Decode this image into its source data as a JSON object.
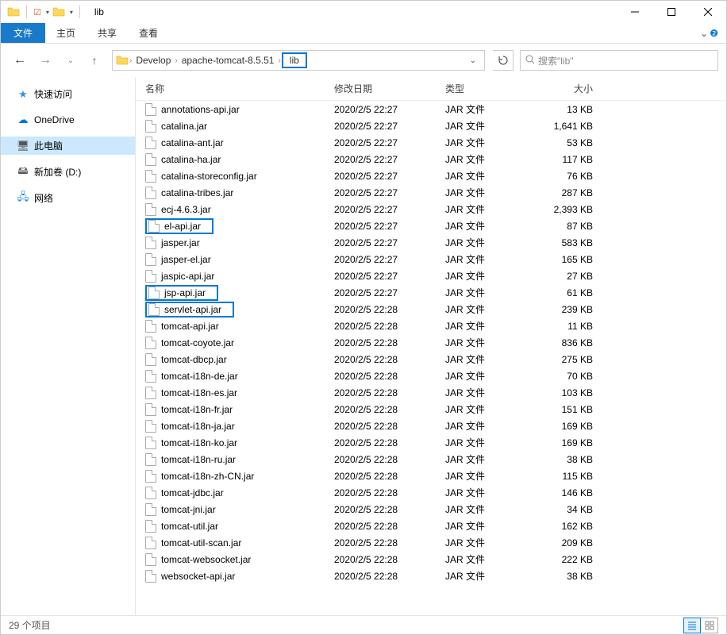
{
  "window": {
    "title": "lib"
  },
  "tabs": {
    "file": "文件",
    "home": "主页",
    "share": "共享",
    "view": "查看"
  },
  "breadcrumb": {
    "items": [
      "Develop",
      "apache-tomcat-8.5.51",
      "lib"
    ]
  },
  "search": {
    "placeholder": "搜索\"lib\""
  },
  "sidebar": {
    "quick_access": "快速访问",
    "onedrive": "OneDrive",
    "this_pc": "此电脑",
    "new_volume": "新加卷 (D:)",
    "network": "网络"
  },
  "columns": {
    "name": "名称",
    "date": "修改日期",
    "type": "类型",
    "size": "大小"
  },
  "file_type": "JAR 文件",
  "files": [
    {
      "name": "annotations-api.jar",
      "date": "2020/2/5 22:27",
      "size": "13 KB",
      "hl": false
    },
    {
      "name": "catalina.jar",
      "date": "2020/2/5 22:27",
      "size": "1,641 KB",
      "hl": false
    },
    {
      "name": "catalina-ant.jar",
      "date": "2020/2/5 22:27",
      "size": "53 KB",
      "hl": false
    },
    {
      "name": "catalina-ha.jar",
      "date": "2020/2/5 22:27",
      "size": "117 KB",
      "hl": false
    },
    {
      "name": "catalina-storeconfig.jar",
      "date": "2020/2/5 22:27",
      "size": "76 KB",
      "hl": false
    },
    {
      "name": "catalina-tribes.jar",
      "date": "2020/2/5 22:27",
      "size": "287 KB",
      "hl": false
    },
    {
      "name": "ecj-4.6.3.jar",
      "date": "2020/2/5 22:27",
      "size": "2,393 KB",
      "hl": false
    },
    {
      "name": "el-api.jar",
      "date": "2020/2/5 22:27",
      "size": "87 KB",
      "hl": true
    },
    {
      "name": "jasper.jar",
      "date": "2020/2/5 22:27",
      "size": "583 KB",
      "hl": false
    },
    {
      "name": "jasper-el.jar",
      "date": "2020/2/5 22:27",
      "size": "165 KB",
      "hl": false
    },
    {
      "name": "jaspic-api.jar",
      "date": "2020/2/5 22:27",
      "size": "27 KB",
      "hl": false
    },
    {
      "name": "jsp-api.jar",
      "date": "2020/2/5 22:27",
      "size": "61 KB",
      "hl": true
    },
    {
      "name": "servlet-api.jar",
      "date": "2020/2/5 22:28",
      "size": "239 KB",
      "hl": true
    },
    {
      "name": "tomcat-api.jar",
      "date": "2020/2/5 22:28",
      "size": "11 KB",
      "hl": false
    },
    {
      "name": "tomcat-coyote.jar",
      "date": "2020/2/5 22:28",
      "size": "836 KB",
      "hl": false
    },
    {
      "name": "tomcat-dbcp.jar",
      "date": "2020/2/5 22:28",
      "size": "275 KB",
      "hl": false
    },
    {
      "name": "tomcat-i18n-de.jar",
      "date": "2020/2/5 22:28",
      "size": "70 KB",
      "hl": false
    },
    {
      "name": "tomcat-i18n-es.jar",
      "date": "2020/2/5 22:28",
      "size": "103 KB",
      "hl": false
    },
    {
      "name": "tomcat-i18n-fr.jar",
      "date": "2020/2/5 22:28",
      "size": "151 KB",
      "hl": false
    },
    {
      "name": "tomcat-i18n-ja.jar",
      "date": "2020/2/5 22:28",
      "size": "169 KB",
      "hl": false
    },
    {
      "name": "tomcat-i18n-ko.jar",
      "date": "2020/2/5 22:28",
      "size": "169 KB",
      "hl": false
    },
    {
      "name": "tomcat-i18n-ru.jar",
      "date": "2020/2/5 22:28",
      "size": "38 KB",
      "hl": false
    },
    {
      "name": "tomcat-i18n-zh-CN.jar",
      "date": "2020/2/5 22:28",
      "size": "115 KB",
      "hl": false
    },
    {
      "name": "tomcat-jdbc.jar",
      "date": "2020/2/5 22:28",
      "size": "146 KB",
      "hl": false
    },
    {
      "name": "tomcat-jni.jar",
      "date": "2020/2/5 22:28",
      "size": "34 KB",
      "hl": false
    },
    {
      "name": "tomcat-util.jar",
      "date": "2020/2/5 22:28",
      "size": "162 KB",
      "hl": false
    },
    {
      "name": "tomcat-util-scan.jar",
      "date": "2020/2/5 22:28",
      "size": "209 KB",
      "hl": false
    },
    {
      "name": "tomcat-websocket.jar",
      "date": "2020/2/5 22:28",
      "size": "222 KB",
      "hl": false
    },
    {
      "name": "websocket-api.jar",
      "date": "2020/2/5 22:28",
      "size": "38 KB",
      "hl": false
    }
  ],
  "status": {
    "count": "29 个项目"
  }
}
